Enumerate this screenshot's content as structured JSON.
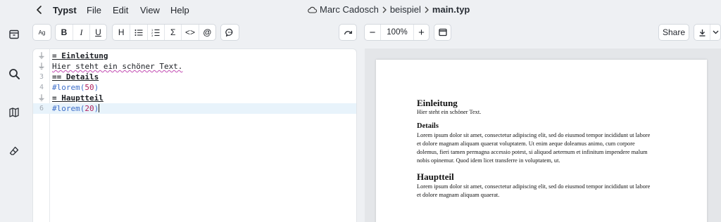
{
  "app": {
    "name": "Typst",
    "menus": [
      "File",
      "Edit",
      "View",
      "Help"
    ]
  },
  "breadcrumb": {
    "owner": "Marc Cadosch",
    "project": "beispiel",
    "file": "main.typ"
  },
  "toolbar": {
    "format_label": "Ag",
    "bold": "B",
    "italic": "I",
    "underline": "U",
    "heading": "H",
    "math": "Σ",
    "code": "<>",
    "reference": "@",
    "zoom": "100%",
    "zoom_out": "−",
    "zoom_in": "+",
    "share": "Share"
  },
  "editor": {
    "lines": [
      {
        "num": "⏚",
        "fold": true,
        "text": "= Einleitung"
      },
      {
        "num": "⏚",
        "fold": true,
        "text": "Hier steht ein schöner Text."
      },
      {
        "num": "3",
        "fold": false,
        "text": "== Details"
      },
      {
        "num": "4",
        "fold": false,
        "text": "#lorem(50)"
      },
      {
        "num": "⏚",
        "fold": true,
        "text": "= Hauptteil"
      },
      {
        "num": "6",
        "fold": false,
        "text": "#lorem(20)"
      }
    ],
    "active_line": 6
  },
  "preview": {
    "h1_intro": "Einleitung",
    "intro_text": "Hier steht ein schöner Text.",
    "h2_details": "Details",
    "details_lines": [
      "Lorem ipsum dolor sit amet, consectetur adipiscing elit, sed do eiusmod tempor incididunt ut labore",
      "et dolore magnam aliquam quaerat voluptatem. Ut enim aeque doleamus animo, cum corpore",
      "dolemus, fieri tamen permagna accessio potest, si aliquod aeternum et infinitum impendere malum",
      "nobis opinemur. Quod idem licet transferre in voluptatem, ut."
    ],
    "h1_main": "Hauptteil",
    "main_lines": [
      "Lorem ipsum dolor sit amet, consectetur adipiscing elit, sed do eiusmod tempor incididunt ut labore",
      "et dolore magnam aliquam quaerat."
    ]
  },
  "colors": {
    "background": "#eef0f3",
    "heading_code": "#1c1f24",
    "function": "#3d6ec9",
    "number": "#b0245f",
    "spellcheck": "#c24bb2",
    "active_line": "#e8f3fb"
  }
}
